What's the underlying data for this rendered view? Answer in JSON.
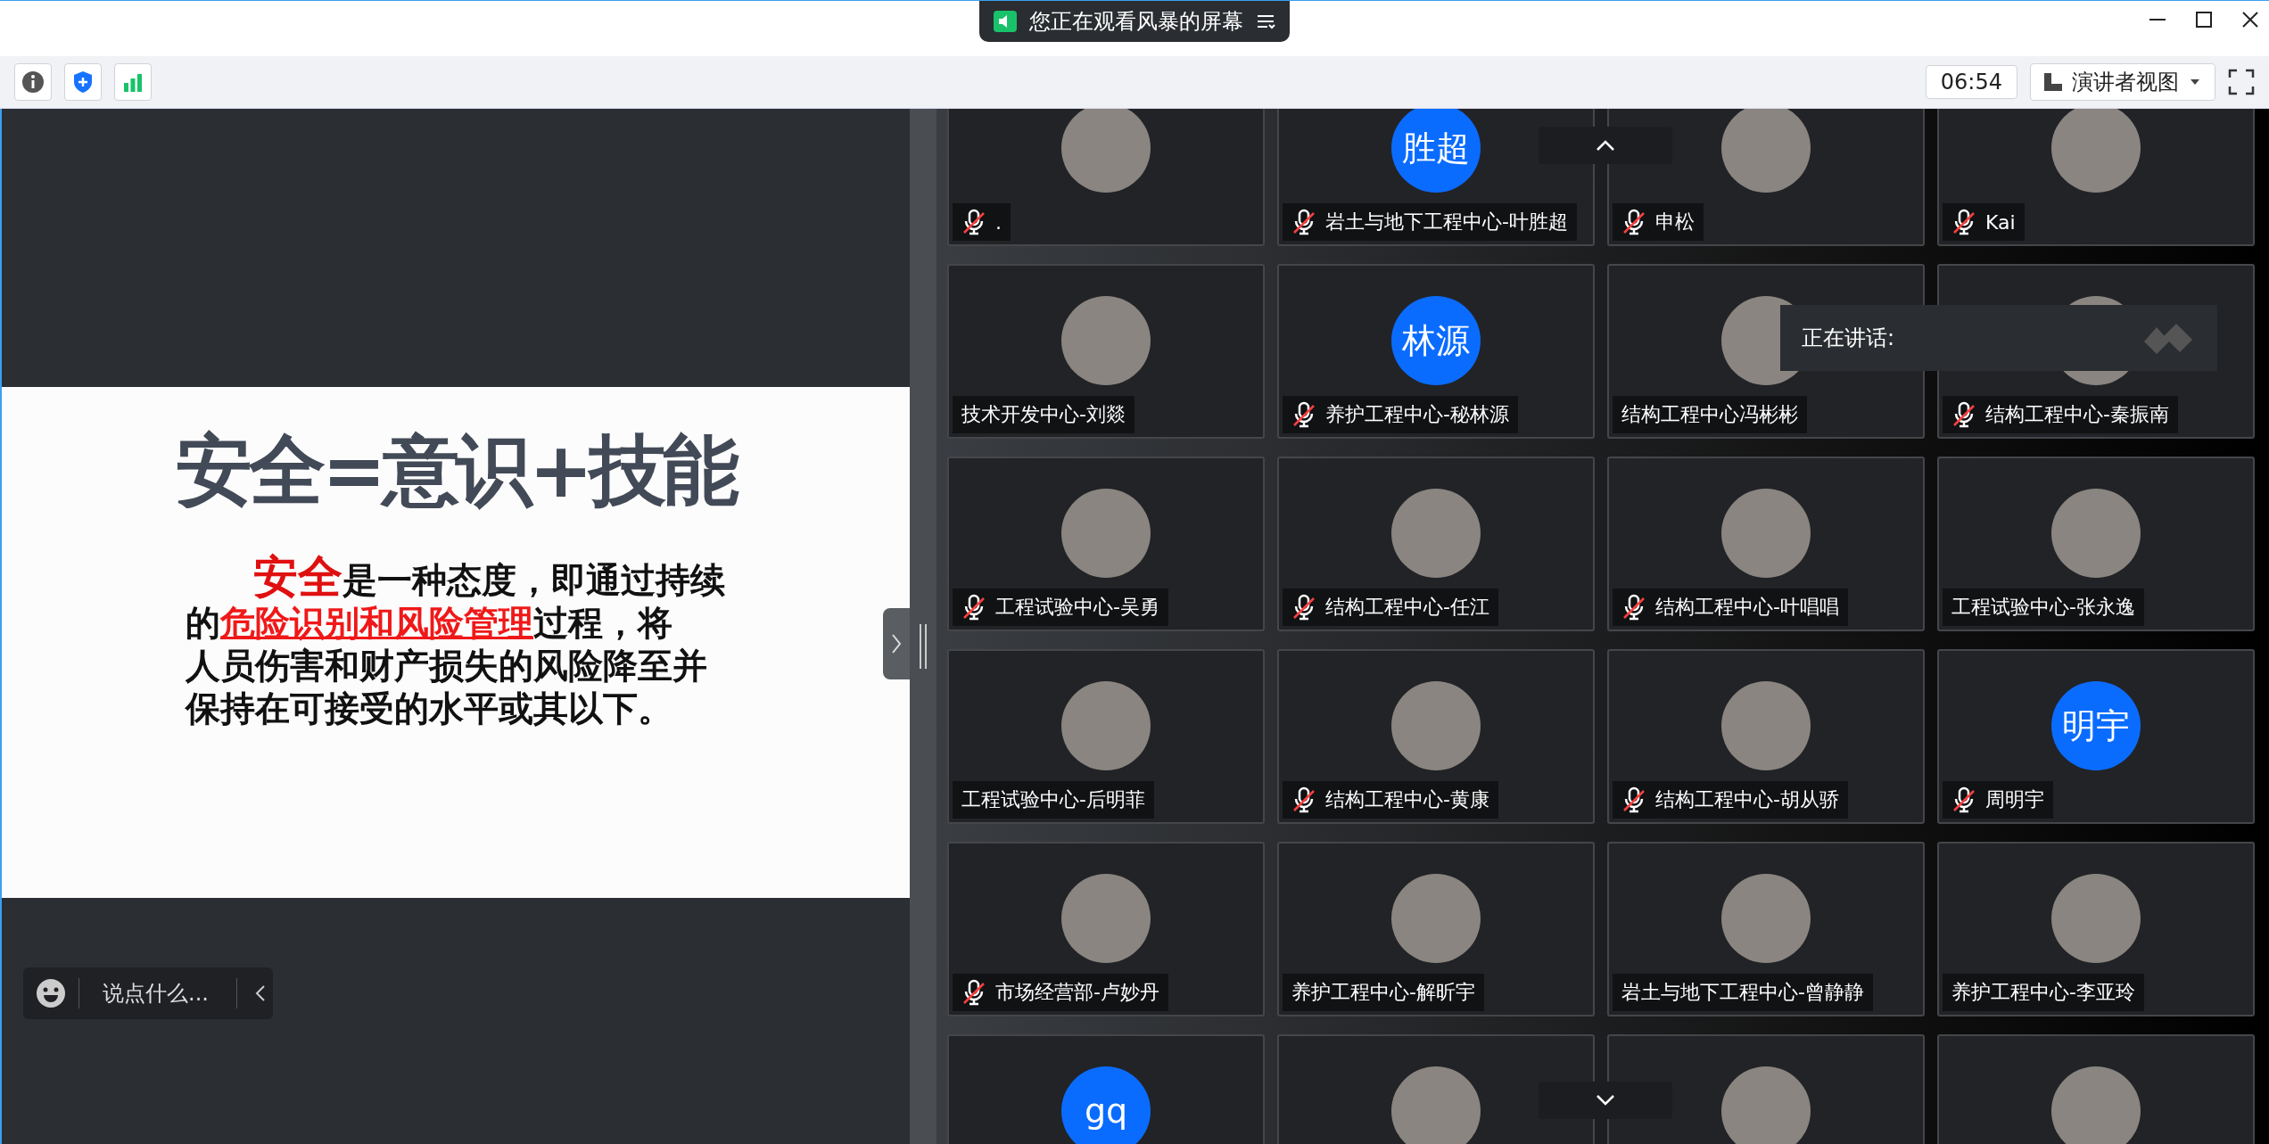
{
  "title_bar": {
    "title": "您正在观看风暴的屏幕"
  },
  "toolbar": {
    "time": "06:54",
    "view_mode": "演讲者视图"
  },
  "slide": {
    "title": "安全=意识+技能",
    "paragraph": [
      [
        {
          "kind": "key",
          "text": "安全"
        },
        {
          "kind": "plain",
          "text": "是一种态度，即通过持续"
        }
      ],
      [
        {
          "kind": "plain",
          "text": "的"
        },
        {
          "kind": "underlined",
          "text": "危险识别和风险管理"
        },
        {
          "kind": "plain",
          "text": "过程，将"
        }
      ],
      [
        {
          "kind": "plain",
          "text": "人员伤害和财产损失的风险降至并"
        }
      ],
      [
        {
          "kind": "plain",
          "text": "保持在可接受的水平或其以下。"
        }
      ]
    ]
  },
  "chat": {
    "placeholder": "说点什么..."
  },
  "speaking": {
    "label": "正在讲话:"
  },
  "participants": [
    {
      "kind": "photo",
      "name": ".",
      "muted": true
    },
    {
      "kind": "initials",
      "initials": "胜超",
      "name": "岩土与地下工程中心-叶胜超",
      "muted": true
    },
    {
      "kind": "photo",
      "name": "申松",
      "muted": true
    },
    {
      "kind": "photo",
      "name": "Kai",
      "muted": true
    },
    {
      "kind": "photo",
      "name": "技术开发中心-刘燚",
      "muted": false
    },
    {
      "kind": "initials",
      "initials": "林源",
      "name": "养护工程中心-秘林源",
      "muted": true
    },
    {
      "kind": "photo",
      "name": "结构工程中心冯彬彬",
      "muted": false
    },
    {
      "kind": "photo",
      "name": "结构工程中心-秦振南",
      "muted": true
    },
    {
      "kind": "photo",
      "name": "工程试验中心-吴勇",
      "muted": true
    },
    {
      "kind": "photo",
      "name": "结构工程中心-任江",
      "muted": true
    },
    {
      "kind": "photo",
      "name": "结构工程中心-叶唱唱",
      "muted": true
    },
    {
      "kind": "photo",
      "name": "工程试验中心-张永逸",
      "muted": false
    },
    {
      "kind": "photo",
      "name": "工程试验中心-后明菲",
      "muted": false
    },
    {
      "kind": "photo",
      "name": "结构工程中心-黄康",
      "muted": true
    },
    {
      "kind": "photo",
      "name": "结构工程中心-胡从骄",
      "muted": true
    },
    {
      "kind": "initials",
      "initials": "明宇",
      "name": "周明宇",
      "muted": true
    },
    {
      "kind": "photo",
      "name": "市场经营部-卢妙丹",
      "muted": true
    },
    {
      "kind": "photo",
      "name": "养护工程中心-解昕宇",
      "muted": false
    },
    {
      "kind": "photo",
      "name": "岩土与地下工程中心-曾静静",
      "muted": false
    },
    {
      "kind": "photo",
      "name": "养护工程中心-李亚玲",
      "muted": false
    },
    {
      "kind": "initials",
      "initials": "gq"
    },
    {
      "kind": "photo"
    },
    {
      "kind": "photo"
    },
    {
      "kind": "photo"
    }
  ]
}
